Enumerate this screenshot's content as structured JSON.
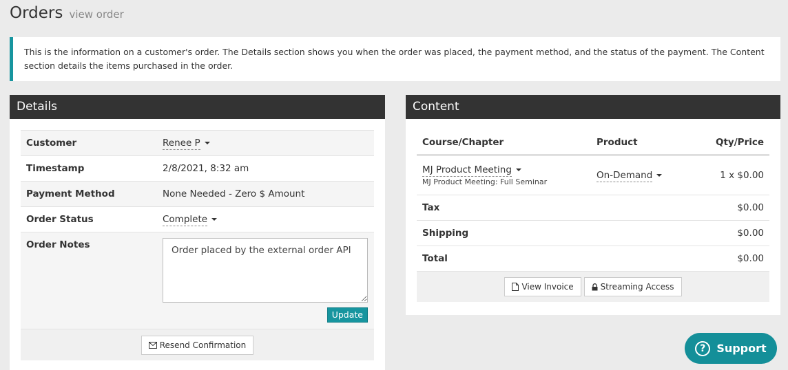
{
  "header": {
    "title": "Orders",
    "subtitle": "view order"
  },
  "info": {
    "text": "This is the information on a customer's order. The Details section shows you when the order was placed, the payment method, and the status of the payment. The Content section details the items purchased in the order."
  },
  "details": {
    "heading": "Details",
    "customer_label": "Customer",
    "customer_value": "Renee P",
    "timestamp_label": "Timestamp",
    "timestamp_value": "2/8/2021, 8:32 am",
    "payment_label": "Payment Method",
    "payment_value": "None Needed - Zero $ Amount",
    "status_label": "Order Status",
    "status_value": "Complete",
    "notes_label": "Order Notes",
    "notes_value": "Order placed by the external order API",
    "update_label": "Update",
    "resend_label": "Resend Confirmation"
  },
  "content": {
    "heading": "Content",
    "columns": [
      "Course/Chapter",
      "Product",
      "Qty/Price"
    ],
    "item": {
      "course": "MJ Product Meeting",
      "chapter": "MJ Product Meeting: Full Seminar",
      "product": "On-Demand",
      "qty_price": "1 x $0.00"
    },
    "tax_label": "Tax",
    "tax_value": "$0.00",
    "shipping_label": "Shipping",
    "shipping_value": "$0.00",
    "total_label": "Total",
    "total_value": "$0.00",
    "invoice_label": "View Invoice",
    "streaming_label": "Streaming Access"
  },
  "support": {
    "label": "Support"
  },
  "colors": {
    "accent": "#17959f",
    "panel_heading": "#333333",
    "background": "#ebebeb"
  },
  "icons": {
    "invoice": "file-icon",
    "streaming": "lock-icon",
    "resend": "envelope-icon",
    "support": "question-circle-icon"
  }
}
